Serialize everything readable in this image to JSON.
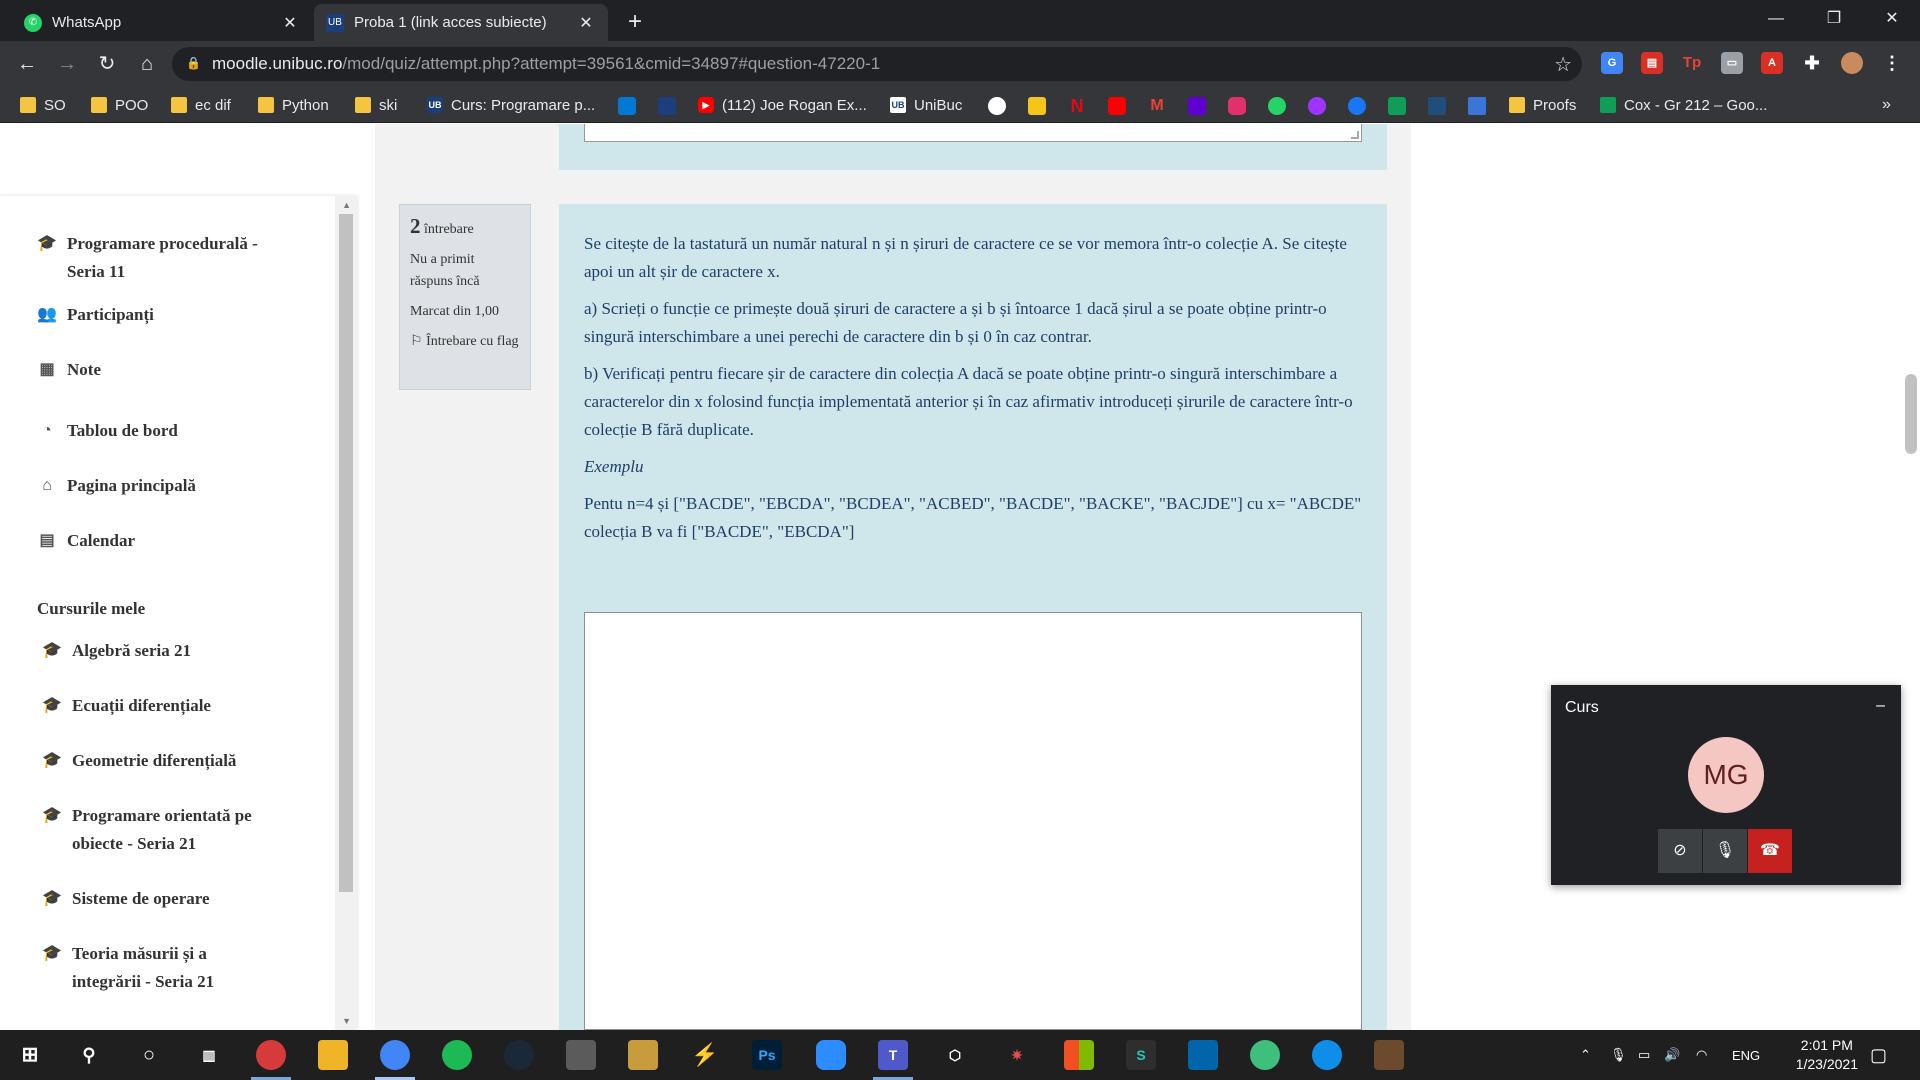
{
  "browser": {
    "tabs": [
      {
        "label": "WhatsApp",
        "active": false
      },
      {
        "label": "Proba 1 (link acces subiecte)",
        "active": true
      }
    ],
    "url_host": "moodle.unibuc.ro",
    "url_path": "/mod/quiz/attempt.php?attempt=39561&cmid=34897#question-47220-1",
    "bookmarks": [
      "SO",
      "POO",
      "ec dif",
      "Python",
      "ski",
      "Curs: Programare p...",
      "(112) Joe Rogan Ex...",
      "UniBuc",
      "Proofs",
      "Cox - Gr 212 – Goo..."
    ],
    "bookmark_more": "»"
  },
  "sidebar": {
    "items": [
      {
        "label": "Programare procedurală - Seria 11",
        "icon": "graduation-cap-icon"
      },
      {
        "label": "Participanți",
        "icon": "users-icon"
      },
      {
        "label": "Note",
        "icon": "table-icon"
      },
      {
        "label": "Tablou de bord",
        "icon": "dashboard-icon"
      },
      {
        "label": "Pagina principală",
        "icon": "home-icon"
      },
      {
        "label": "Calendar",
        "icon": "calendar-icon"
      }
    ],
    "section_title": "Cursurile mele",
    "courses": [
      "Algebră seria 21",
      "Ecuații diferențiale",
      "Geometrie diferențială",
      "Programare orientată pe obiecte - Seria 21",
      "Sisteme de operare",
      "Teoria măsurii și a integrării - Seria 21"
    ]
  },
  "question": {
    "number": "2",
    "word": "întrebare",
    "status": "Nu a primit răspuns încă",
    "marked": "Marcat din 1,00",
    "flag_label": "Întrebare cu flag"
  },
  "text": {
    "p1": "Se citește de la tastatură un număr natural n și n șiruri de caractere ce se vor memora într-o colecție A. Se citește apoi un alt șir de caractere x.",
    "p2": "a)      Scrieți o funcție ce primește două șiruri de caractere a și b și întoarce 1 dacă șirul a se poate obține printr-o singură interschimbare a unei perechi de caractere din b și 0 în caz contrar.",
    "p3": "b)     Verificați pentru fiecare șir de caractere din colecția A dacă se poate obține printr-o singură interschimbare a caracterelor din x folosind funcția implementată anterior și în caz afirmativ introduceți șirurile de caractere într-o colecție B fără duplicate.",
    "example_title": "Exemplu",
    "example": "Pentu n=4 și [\"BACDE\", \"EBCDA\", \"BCDEA\", \"ACBED\", \"BACDE\", \"BACKE\", \"BACJDE\"] cu x= \"ABCDE\" colecția B va fi [\"BACDE\", \"EBCDA\"]"
  },
  "meet": {
    "title": "Curs",
    "minimize": "–",
    "avatar": "MG"
  },
  "taskbar": {
    "lang": "ENG",
    "time": "2:01 PM",
    "date": "1/23/2021"
  },
  "colors": {
    "panel": "#cfe6ea",
    "question_text": "#1f3f6a",
    "chrome_dark": "#202124"
  }
}
